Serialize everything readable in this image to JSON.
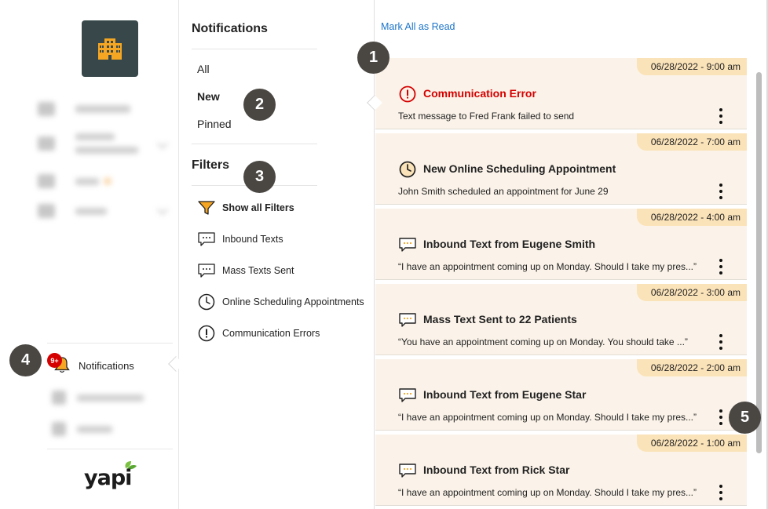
{
  "left_nav": {
    "notifications_label": "Notifications",
    "badge": "9+"
  },
  "mid_panel": {
    "notifications_title": "Notifications",
    "tabs": [
      "All",
      "New",
      "Pinned"
    ],
    "active_tab": "New",
    "filters_title": "Filters",
    "filters": [
      {
        "label": "Show all Filters",
        "icon": "funnel-icon"
      },
      {
        "label": "Inbound Texts",
        "icon": "chat-icon"
      },
      {
        "label": "Mass Texts Sent",
        "icon": "chat-icon"
      },
      {
        "label": "Online Scheduling Appointments",
        "icon": "clock-icon"
      },
      {
        "label": "Communication Errors",
        "icon": "alert-icon"
      }
    ]
  },
  "right_panel": {
    "mark_all_label": "Mark All as Read",
    "notifications": [
      {
        "date": "06/28/2022 - 9:00 am",
        "icon": "alert-icon",
        "title": "Communication Error",
        "message": "Text message to Fred Frank failed to send",
        "error": true
      },
      {
        "date": "06/28/2022 - 7:00 am",
        "icon": "clock-icon",
        "title": "New Online Scheduling Appointment",
        "message": "John Smith scheduled an appointment for June 29",
        "error": false
      },
      {
        "date": "06/28/2022 - 4:00 am",
        "icon": "chat-icon",
        "title": "Inbound Text from Eugene Smith",
        "message": "“I have an appointment coming up on Monday. Should I take my pres...”",
        "error": false
      },
      {
        "date": "06/28/2022 - 3:00 am",
        "icon": "chat-icon",
        "title": "Mass Text Sent to 22 Patients",
        "message": "“You have an appointment coming up on Monday.  You should take ...”",
        "error": false
      },
      {
        "date": "06/28/2022 - 2:00 am",
        "icon": "chat-icon",
        "title": "Inbound Text from Eugene Star",
        "message": "“I have an appointment coming up on Monday. Should I take my pres...”",
        "error": false
      },
      {
        "date": "06/28/2022 - 1:00 am",
        "icon": "chat-icon",
        "title": "Inbound Text from Rick Star",
        "message": "“I have an appointment coming up on Monday. Should I take my pres...”",
        "error": false
      }
    ]
  },
  "callouts": [
    "1",
    "2",
    "3",
    "4",
    "5"
  ],
  "colors": {
    "error_red": "#d50000",
    "link_blue": "#1c74c9",
    "card_bg": "#fbf3e9",
    "date_tab": "#fbe3b9",
    "logo_tile": "#37474a",
    "building_orange": "#f5a623",
    "marker": "#4a4743"
  }
}
